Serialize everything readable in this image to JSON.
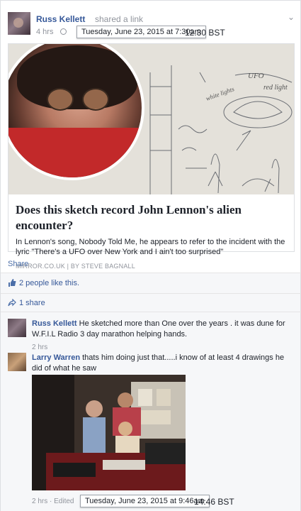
{
  "post": {
    "author": "Russ Kellett",
    "action": "shared a link",
    "time": "4 hrs",
    "tooltip": "Tuesday, June 23, 2015 at 7:30am",
    "local_time": "12:30 BST",
    "menu_icon": "chevron-down-icon"
  },
  "link": {
    "title": "Does this sketch record John Lennon's alien encounter?",
    "description": "In Lennon's song, Nobody Told Me, he appears to refer to the incident with the lyric \"There's a UFO over New York and I ain't too surprised\"",
    "source": "MIRROR.CO.UK",
    "separator": "|",
    "byline": "BY STEVE BAGNALL",
    "sketch_labels": {
      "ufo": "UFO",
      "red": "red light",
      "white": "white lights"
    }
  },
  "actions": {
    "share": "Share"
  },
  "likes": {
    "icon": "thumbs-up-icon",
    "text": "2 people like this."
  },
  "shares": {
    "icon": "share-arrow-icon",
    "text": "1 share"
  },
  "comments": [
    {
      "author": "Russ Kellett",
      "text": "He sketched more than One over the years . it was dune for W.F.I.L Radio 3 day marathon helping hands.",
      "time": "2 hrs"
    },
    {
      "author": "Larry Warren",
      "text": "thats him doing just that.....i know of at least 4 drawings he did of what he saw",
      "time": "2 hrs",
      "edited": "Edited",
      "tooltip": "Tuesday, June 23, 2015 at 9:46am",
      "local_time": "14:46 BST"
    }
  ]
}
